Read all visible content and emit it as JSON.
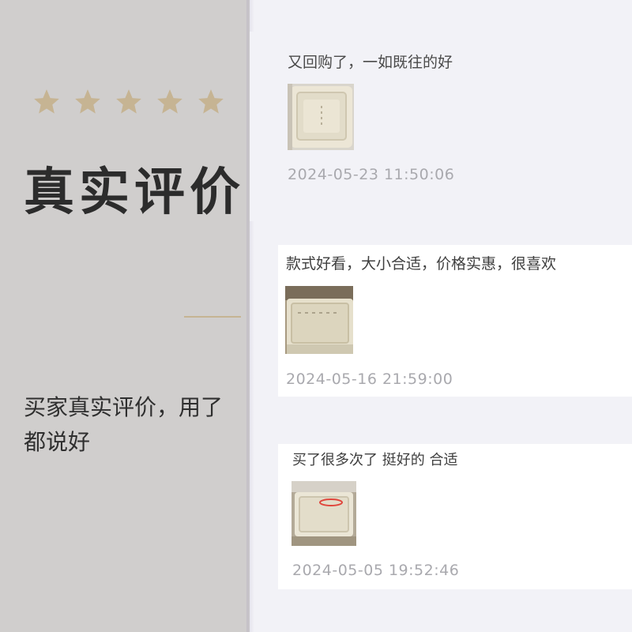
{
  "hero": {
    "rating_stars": 5,
    "title": "真实评价",
    "subtitle": "买家真实评价，用了都说好",
    "star_color": "#c6b493"
  },
  "reviews": [
    {
      "text": "又回购了，一如既往的好",
      "date": "2024-05-23 11:50:06",
      "photo": "beige-lunchbox-photo"
    },
    {
      "text": "款式好看，大小合适，价格实惠，很喜欢",
      "date": "2024-05-16 21:59:00",
      "photo": "beige-lunchbox-photo"
    },
    {
      "text": "买了很多次了 挺好的 合适",
      "date": "2024-05-05 19:52:46",
      "photo": "beige-lunchbox-photo"
    }
  ]
}
